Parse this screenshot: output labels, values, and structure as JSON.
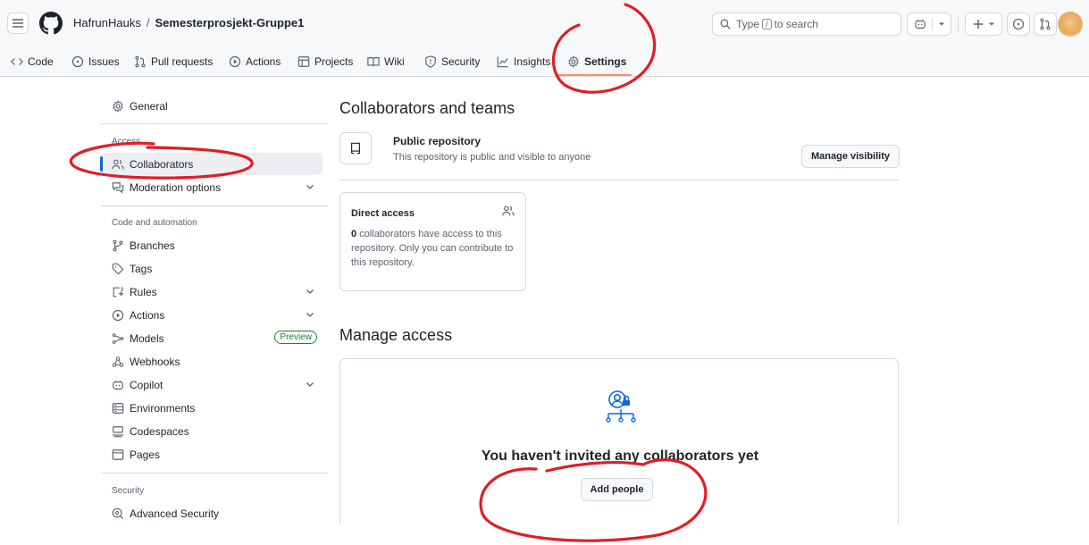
{
  "header": {
    "owner": "HafrunHauks",
    "separator": "/",
    "repo": "Semesterprosjekt-Gruppe1",
    "search_prefix": "Type",
    "search_key": "/",
    "search_suffix": "to search"
  },
  "tabs": [
    {
      "label": "Code",
      "icon": "code-icon"
    },
    {
      "label": "Issues",
      "icon": "issue-icon"
    },
    {
      "label": "Pull requests",
      "icon": "pull-request-icon"
    },
    {
      "label": "Actions",
      "icon": "play-icon"
    },
    {
      "label": "Projects",
      "icon": "table-icon"
    },
    {
      "label": "Wiki",
      "icon": "book-icon"
    },
    {
      "label": "Security",
      "icon": "shield-icon"
    },
    {
      "label": "Insights",
      "icon": "graph-icon"
    },
    {
      "label": "Settings",
      "icon": "gear-icon",
      "active": true
    }
  ],
  "sidebar": {
    "general": "General",
    "access_heading": "Access",
    "collaborators": "Collaborators",
    "moderation": "Moderation options",
    "code_automation_heading": "Code and automation",
    "branches": "Branches",
    "tags": "Tags",
    "rules": "Rules",
    "actions": "Actions",
    "models": "Models",
    "models_badge": "Preview",
    "webhooks": "Webhooks",
    "copilot": "Copilot",
    "environments": "Environments",
    "codespaces": "Codespaces",
    "pages": "Pages",
    "security_heading": "Security",
    "advanced_security": "Advanced Security"
  },
  "main": {
    "collab_title": "Collaborators and teams",
    "public_title": "Public repository",
    "public_desc": "This repository is public and visible to anyone",
    "manage_visibility": "Manage visibility",
    "direct_access_title": "Direct access",
    "direct_access_count": "0",
    "direct_access_text": "collaborators have access to this repository. Only you can contribute to this repository.",
    "manage_access_title": "Manage access",
    "empty_title": "You haven't invited any collaborators yet",
    "add_people": "Add people"
  },
  "colors": {
    "accent": "#0969da",
    "selected_bg": "#eceef1",
    "annotation": "#e01e25",
    "tab_underline": "#fd8c73",
    "preview_green": "#1a7f37"
  }
}
